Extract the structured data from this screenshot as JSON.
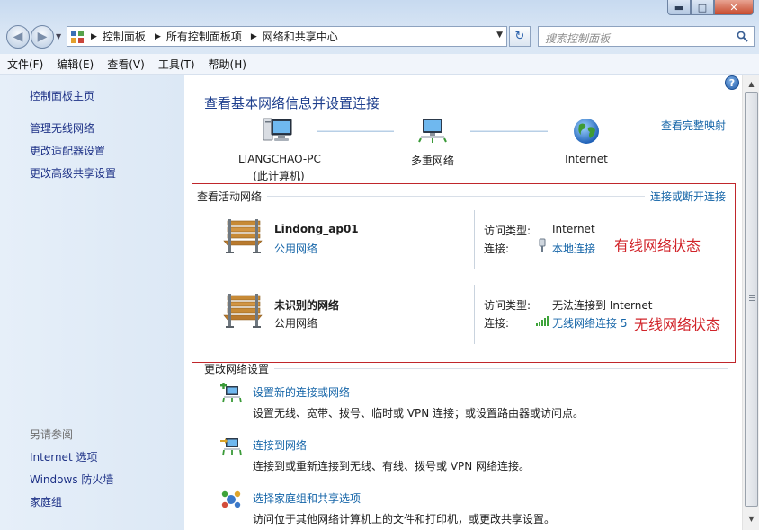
{
  "window": {
    "controls": {
      "minimize": "▬",
      "maximize": "□",
      "close": "✕"
    }
  },
  "address": {
    "crumbs": [
      "控制面板",
      "所有控制面板项",
      "网络和共享中心"
    ],
    "search_placeholder": "搜索控制面板"
  },
  "menu": [
    "文件(F)",
    "编辑(E)",
    "查看(V)",
    "工具(T)",
    "帮助(H)"
  ],
  "sidebar": {
    "home": "控制面板主页",
    "links": [
      "管理无线网络",
      "更改适配器设置",
      "更改高级共享设置"
    ],
    "see_also_title": "另请参阅",
    "see_also": [
      "Internet 选项",
      "Windows 防火墙",
      "家庭组"
    ]
  },
  "main": {
    "title": "查看基本网络信息并设置连接",
    "full_map_link": "查看完整映射",
    "map": {
      "computer_name": "LIANGCHAO-PC",
      "computer_sub": "(此计算机)",
      "middle": "多重网络",
      "internet": "Internet"
    },
    "active": {
      "title": "查看活动网络",
      "connect_link": "连接或断开连接",
      "networks": [
        {
          "name": "Lindong_ap01",
          "type": "公用网络",
          "type_is_link": true,
          "access_label": "访问类型:",
          "access_value": "Internet",
          "conn_label": "连接:",
          "conn_value": "本地连接",
          "annotation": "有线网络状态"
        },
        {
          "name": "未识别的网络",
          "type": "公用网络",
          "type_is_link": false,
          "access_label": "访问类型:",
          "access_value": "无法连接到 Internet",
          "conn_label": "连接:",
          "conn_value": "无线网络连接 5",
          "annotation": "无线网络状态"
        }
      ]
    },
    "change": {
      "title": "更改网络设置",
      "tasks": [
        {
          "link": "设置新的连接或网络",
          "desc": "设置无线、宽带、拨号、临时或 VPN 连接；或设置路由器或访问点。"
        },
        {
          "link": "连接到网络",
          "desc": "连接到或重新连接到无线、有线、拨号或 VPN 网络连接。"
        },
        {
          "link": "选择家庭组和共享选项",
          "desc": "访问位于其他网络计算机上的文件和打印机，或更改共享设置。"
        }
      ]
    }
  },
  "colors": {
    "link": "#1565a8",
    "title": "#1e3f8e",
    "annotation": "#d1242a",
    "sidebar_link": "#1e3287"
  },
  "icons": {
    "help": "?",
    "back": "◀",
    "forward": "▶",
    "refresh": "↻"
  }
}
